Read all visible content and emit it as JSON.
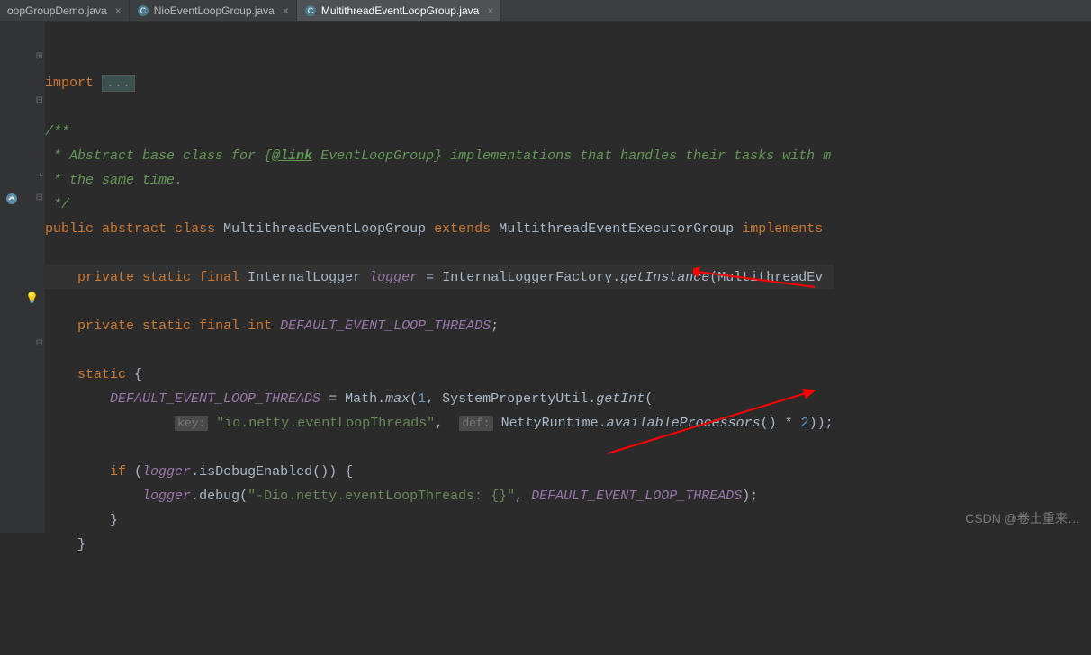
{
  "tabs": [
    {
      "label": "oopGroupDemo.java"
    },
    {
      "label": "NioEventLoopGroup.java"
    },
    {
      "label": "MultithreadEventLoopGroup.java"
    }
  ],
  "code": {
    "import_kw": "import",
    "import_ellipsis": "...",
    "doc_open": "/**",
    "doc_l1a": " * Abstract base class for {",
    "doc_link": "@link",
    "doc_l1b": " EventLoopGroup} implementations that handles their tasks with m",
    "doc_l2": " * the same time.",
    "doc_close": " */",
    "kw_public": "public",
    "kw_abstract": "abstract",
    "kw_class": "class",
    "class_name": "MultithreadEventLoopGroup",
    "kw_extends": "extends",
    "super_class": "MultithreadEventExecutorGroup",
    "kw_implements": "implements",
    "kw_private": "private",
    "kw_static": "static",
    "kw_final": "final",
    "type_logger": "InternalLogger",
    "field_logger": "logger",
    "logger_init": "InternalLoggerFactory",
    "getInstance": "getInstance",
    "getInstance_arg": "MultithreadEv",
    "kw_int": "int",
    "field_threads": "DEFAULT_EVENT_LOOP_THREADS",
    "static_open": "{",
    "math_class": "Math",
    "method_max": "max",
    "num_1": "1",
    "spu": "SystemPropertyUtil",
    "getInt": "getInt",
    "hint_key": "key:",
    "str_key": "\"io.netty.eventLoopThreads\"",
    "hint_def": "def:",
    "nr": "NettyRuntime",
    "avail": "availableProcessors",
    "num_2": "2",
    "kw_if": "if",
    "isDebug": "isDebugEnabled",
    "debug": "debug",
    "str_debug": "\"-Dio.netty.eventLoopThreads: {}\"",
    "brace_close": "}"
  },
  "watermark": "CSDN @卷土重来…"
}
